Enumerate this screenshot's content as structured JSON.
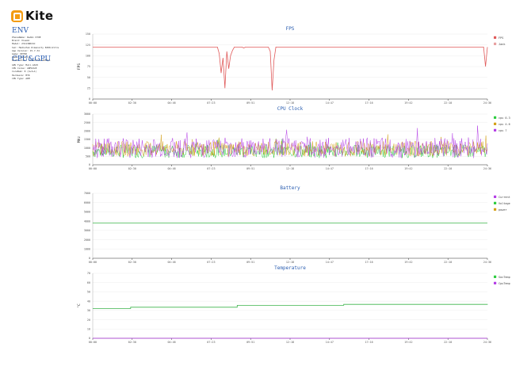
{
  "header": {
    "logo_text": "Kite"
  },
  "env": {
    "title": "ENV",
    "lines": [
      "PhoneName: Redmi K70E",
      "Brand: Xiaomi",
      "Model: 23113RKC6C",
      "SoC: MediaTek Dimensity 8300-Ultra",
      "App Version: 15.7.34",
      "Game: KEYRO",
      "Game: Genshin",
      "Resolution: 1220x2712 405dpi"
    ]
  },
  "cpu_gpu": {
    "title": "CPU&GPU",
    "lines": [
      "GPU Type: Mali-G615",
      "CPU Cores: ARMv9x8",
      "CoreNum: 8 (4+3+1)",
      "Hardware: MTK",
      "CPU Type: ARM"
    ]
  },
  "time_ticks": [
    "00:00",
    "02:30",
    "04:46",
    "07:23",
    "09:51",
    "12:18",
    "14:47",
    "17:16",
    "19:42",
    "22:10",
    "24:36"
  ],
  "chart_data": [
    {
      "type": "line",
      "title": "FPS",
      "ylabel": "FPS",
      "ylim": [
        0,
        150
      ],
      "yticks": [
        0,
        25,
        50,
        75,
        100,
        125,
        150
      ],
      "series": [
        {
          "name": "FPS",
          "color": "#e05a5a",
          "values": [
            120,
            120,
            120,
            120,
            120,
            120,
            120,
            120,
            120,
            120,
            120,
            120,
            120,
            120,
            120,
            120,
            120,
            120,
            120,
            120,
            120,
            120,
            120,
            120,
            120,
            120,
            120,
            120,
            120,
            120,
            120,
            120,
            120,
            120,
            120,
            120,
            120,
            120,
            120,
            120,
            120,
            120,
            120,
            120,
            120,
            120,
            120,
            120,
            120,
            120,
            120,
            120,
            120,
            120,
            120,
            120,
            120,
            120,
            120,
            120,
            120,
            120,
            120,
            120,
            120,
            120,
            120,
            105,
            60,
            95,
            25,
            110,
            70,
            100,
            112,
            120,
            120,
            120,
            120,
            120,
            118,
            120,
            120,
            120,
            120,
            120,
            120,
            120,
            120,
            120,
            120,
            120,
            120,
            120,
            110,
            20,
            90,
            120,
            120,
            120,
            120,
            120,
            120,
            120,
            120,
            120,
            120,
            120,
            120,
            120,
            120,
            120,
            120,
            120,
            120,
            120,
            120,
            120,
            120,
            120,
            120,
            120,
            120,
            120,
            120,
            120,
            120,
            120,
            120,
            120,
            120,
            120,
            120,
            120,
            120,
            120,
            120,
            120,
            120,
            120,
            120,
            120,
            120,
            120,
            120,
            120,
            120,
            120,
            120,
            120,
            120,
            120,
            120,
            120,
            120,
            120,
            120,
            120,
            120,
            120,
            120,
            120,
            120,
            120,
            120,
            120,
            120,
            120,
            120,
            120,
            120,
            120,
            120,
            120,
            120,
            120,
            120,
            120,
            120,
            120,
            120,
            120,
            120,
            120,
            120,
            120,
            120,
            120,
            120,
            120,
            120,
            120,
            120,
            120,
            120,
            120,
            120,
            120,
            120,
            120,
            120,
            120,
            120,
            120,
            120,
            120,
            120,
            120,
            75,
            120
          ]
        }
      ],
      "legend": [
        {
          "label": "FPS",
          "color": "#e05a5a"
        },
        {
          "label": "Jank",
          "color": "#e8a0a0"
        }
      ]
    },
    {
      "type": "line",
      "title": "CPU Clock",
      "ylabel": "MHz",
      "ylim": [
        0,
        3000
      ],
      "yticks": [
        0,
        500,
        1000,
        1500,
        2000,
        2500,
        3000
      ],
      "series": [
        {
          "name": "cpu 0-3",
          "color": "#2ecc40",
          "base": 800,
          "spread": 400,
          "values": []
        },
        {
          "name": "cpu 4-6",
          "color": "#d4a017",
          "base": 950,
          "spread": 450,
          "values": []
        },
        {
          "name": "cpu 7",
          "color": "#b43ee6",
          "base": 1000,
          "spread": 600,
          "values": []
        }
      ],
      "legend": [
        {
          "label": "cpu 0-3",
          "color": "#2ecc40"
        },
        {
          "label": "cpu 4-6",
          "color": "#d4a017"
        },
        {
          "label": "cpu 7",
          "color": "#b43ee6"
        }
      ]
    },
    {
      "type": "line",
      "title": "Battery",
      "ylabel": "",
      "ylim": [
        0,
        7000
      ],
      "yticks": [
        0,
        1000,
        2000,
        3000,
        4000,
        5000,
        6000,
        7000
      ],
      "series": [
        {
          "name": "Voltage",
          "color": "#3cb44b",
          "values": [
            3800,
            3800
          ]
        }
      ],
      "legend": [
        {
          "label": "Current",
          "color": "#b43ee6"
        },
        {
          "label": "Voltage",
          "color": "#2ecc40"
        },
        {
          "label": "power",
          "color": "#d4a017"
        }
      ]
    },
    {
      "type": "line",
      "title": "Temperature",
      "ylabel": "°C",
      "ylim": [
        0,
        70
      ],
      "yticks": [
        0,
        10,
        20,
        30,
        40,
        50,
        60,
        70
      ],
      "series": [
        {
          "name": "SocTemp",
          "color": "#3cb44b",
          "steps": [
            [
              0,
              32
            ],
            [
              0.096,
              33.5
            ],
            [
              0.366,
              35.5
            ],
            [
              0.636,
              36.5
            ],
            [
              1.0,
              37
            ]
          ]
        },
        {
          "name": "CpuTemp",
          "color": "#b43ee6",
          "steps": [
            [
              0,
              0
            ],
            [
              1.0,
              0
            ]
          ]
        }
      ],
      "legend": [
        {
          "label": "SocTemp",
          "color": "#2ecc40"
        },
        {
          "label": "CpuTemp",
          "color": "#b43ee6"
        }
      ]
    }
  ]
}
